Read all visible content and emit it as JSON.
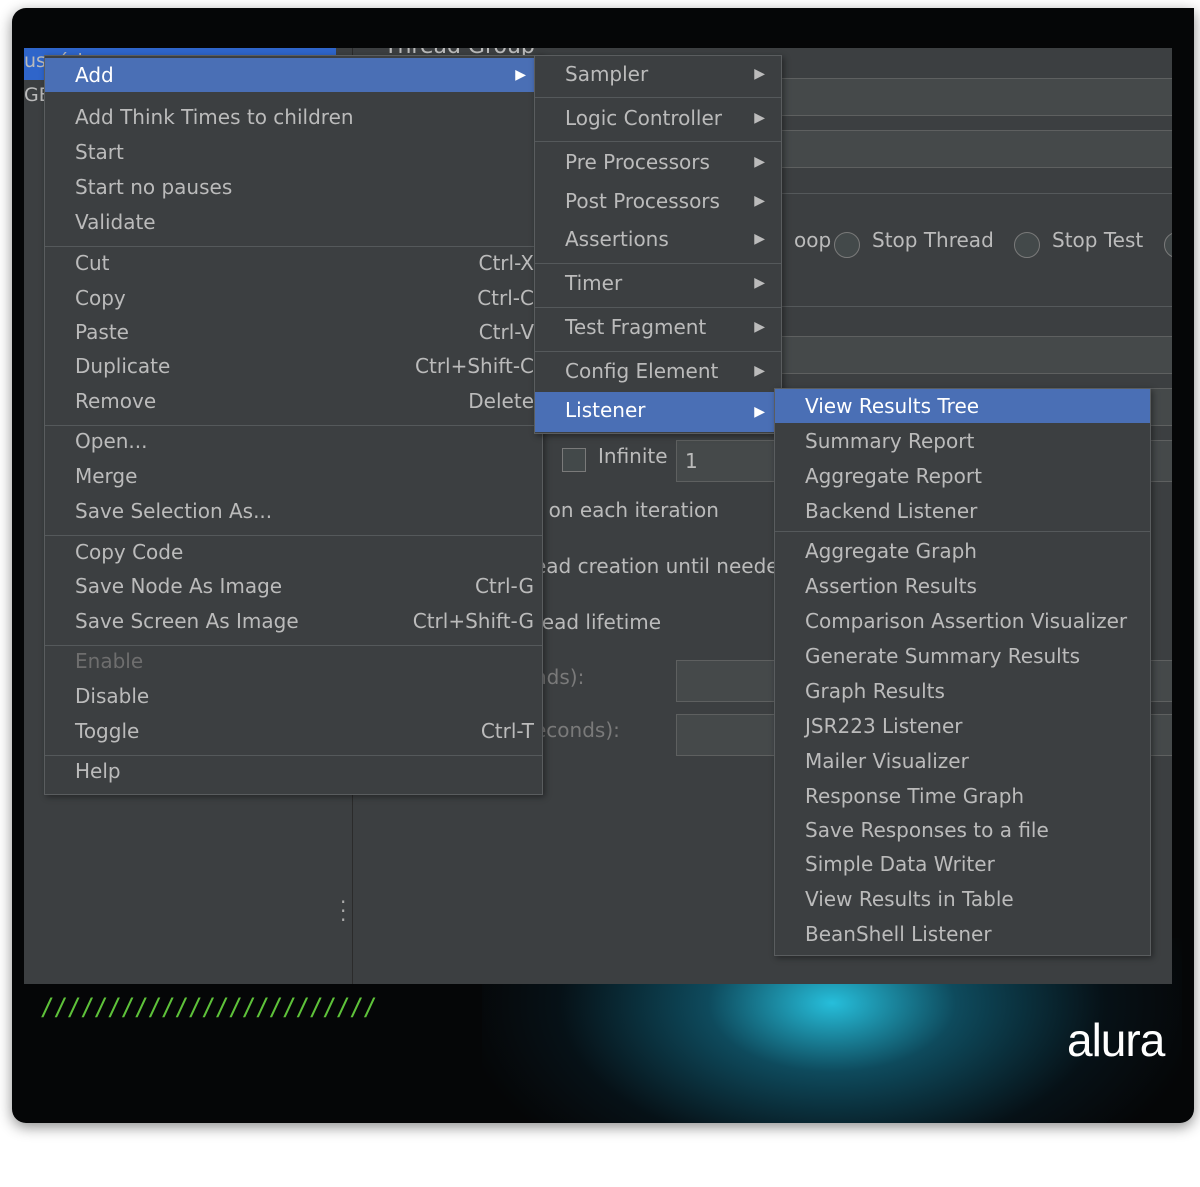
{
  "background_text": {
    "tree_item_1": "usuários",
    "tree_item_2": "GE",
    "panel_title": "Thread Group",
    "loop_option": "oop",
    "stop_thread": "Stop Thread",
    "stop_test": "Stop Test",
    "infinite_label": "Infinite",
    "loop_count_value": "1",
    "same_user_iteration": "r on each iteration",
    "delay_thread_creation": "ead creation until neede",
    "specify_thread_lifetime": "read lifetime",
    "duration_label": "nds):",
    "startup_delay_label": "econds):"
  },
  "context_menu": {
    "add": "Add",
    "add_think_times": "Add Think Times to children",
    "start": "Start",
    "start_no_pauses": "Start no pauses",
    "validate": "Validate",
    "cut": "Cut",
    "cut_sc": "Ctrl-X",
    "copy": "Copy",
    "copy_sc": "Ctrl-C",
    "paste": "Paste",
    "paste_sc": "Ctrl-V",
    "duplicate": "Duplicate",
    "duplicate_sc": "Ctrl+Shift-C",
    "remove": "Remove",
    "remove_sc": "Delete",
    "open": "Open...",
    "merge": "Merge",
    "save_selection_as": "Save Selection As...",
    "copy_code": "Copy Code",
    "save_node_as_image": "Save Node As Image",
    "save_node_sc": "Ctrl-G",
    "save_screen_as_image": "Save Screen As Image",
    "save_screen_sc": "Ctrl+Shift-G",
    "enable": "Enable",
    "disable": "Disable",
    "toggle": "Toggle",
    "toggle_sc": "Ctrl-T",
    "help": "Help"
  },
  "add_submenu": {
    "sampler": "Sampler",
    "logic_controller": "Logic Controller",
    "pre_processors": "Pre Processors",
    "post_processors": "Post Processors",
    "assertions": "Assertions",
    "timer": "Timer",
    "test_fragment": "Test Fragment",
    "config_element": "Config Element",
    "listener": "Listener"
  },
  "listener_submenu": [
    "View Results Tree",
    "Summary Report",
    "Aggregate Report",
    "Backend Listener",
    "Aggregate Graph",
    "Assertion Results",
    "Comparison Assertion Visualizer",
    "Generate Summary Results",
    "Graph Results",
    "JSR223 Listener",
    "Mailer Visualizer",
    "Response Time Graph",
    "Save Responses to a file",
    "Simple Data Writer",
    "View Results in Table",
    "BeanShell Listener"
  ],
  "branding": {
    "logo_text": "alura",
    "stripes": "/////////////////////////",
    "accent_color": "#5ec23a",
    "glow_color": "#28c8e6"
  },
  "colors": {
    "selection": "#4a6fb5",
    "menu_bg": "#3c3f41"
  }
}
